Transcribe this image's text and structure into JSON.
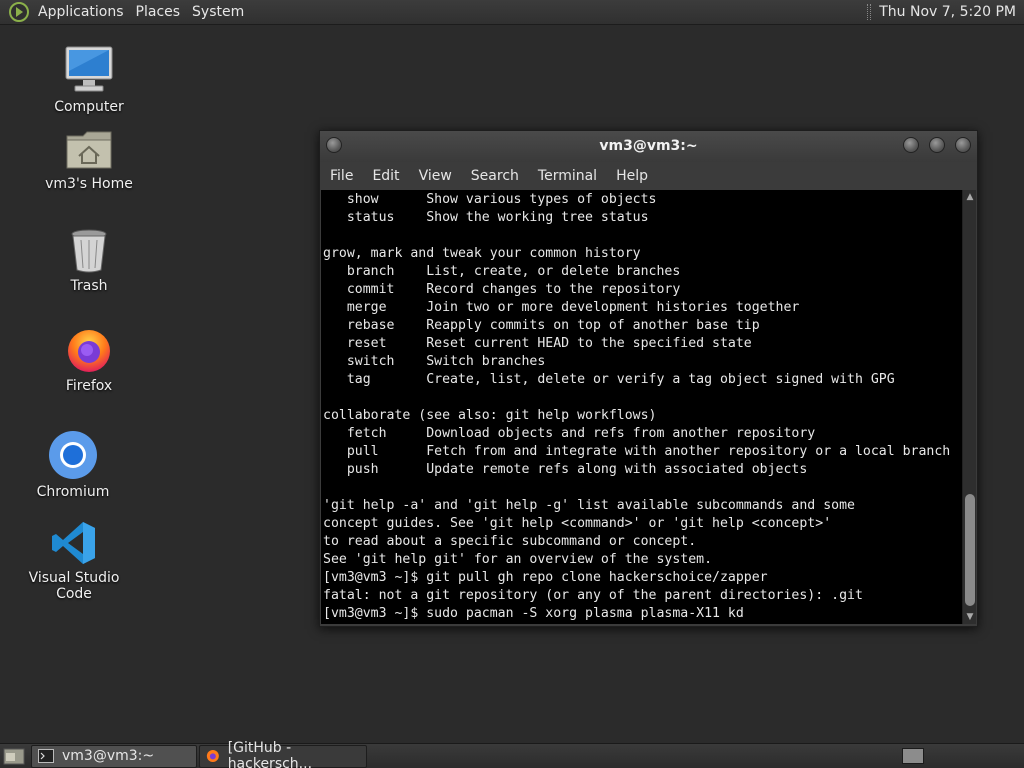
{
  "top_panel": {
    "menus": [
      "Applications",
      "Places",
      "System"
    ],
    "clock": "Thu Nov 7,  5:20 PM"
  },
  "desktop_icons": [
    {
      "label": "Computer",
      "icon": "computer-icon"
    },
    {
      "label": "vm3's Home",
      "icon": "home-folder-icon"
    },
    {
      "label": "Trash",
      "icon": "trash-icon"
    },
    {
      "label": "Firefox",
      "icon": "firefox-icon"
    },
    {
      "label": "Chromium",
      "icon": "chromium-icon"
    },
    {
      "label": "Visual Studio Code",
      "icon": "vscode-icon"
    }
  ],
  "terminal": {
    "title": "vm3@vm3:~",
    "menu": [
      "File",
      "Edit",
      "View",
      "Search",
      "Terminal",
      "Help"
    ],
    "lines": [
      "   show      Show various types of objects",
      "   status    Show the working tree status",
      "",
      "grow, mark and tweak your common history",
      "   branch    List, create, or delete branches",
      "   commit    Record changes to the repository",
      "   merge     Join two or more development histories together",
      "   rebase    Reapply commits on top of another base tip",
      "   reset     Reset current HEAD to the specified state",
      "   switch    Switch branches",
      "   tag       Create, list, delete or verify a tag object signed with GPG",
      "",
      "collaborate (see also: git help workflows)",
      "   fetch     Download objects and refs from another repository",
      "   pull      Fetch from and integrate with another repository or a local branch",
      "   push      Update remote refs along with associated objects",
      "",
      "'git help -a' and 'git help -g' list available subcommands and some",
      "concept guides. See 'git help <command>' or 'git help <concept>'",
      "to read about a specific subcommand or concept.",
      "See 'git help git' for an overview of the system.",
      "[vm3@vm3 ~]$ git pull gh repo clone hackerschoice/zapper",
      "fatal: not a git repository (or any of the parent directories): .git",
      "[vm3@vm3 ~]$ sudo pacman -S xorg plasma plasma-X11 kd"
    ]
  },
  "taskbar": {
    "tasks": [
      {
        "label": "vm3@vm3:~",
        "icon": "terminal-icon",
        "active": true
      },
      {
        "label": "[GitHub - hackersch...",
        "icon": "firefox-icon",
        "active": false
      }
    ]
  },
  "colors": {
    "desktop_bg": "#2b2b2b",
    "terminal_bg": "#000000",
    "terminal_fg": "#e8e8e8"
  }
}
